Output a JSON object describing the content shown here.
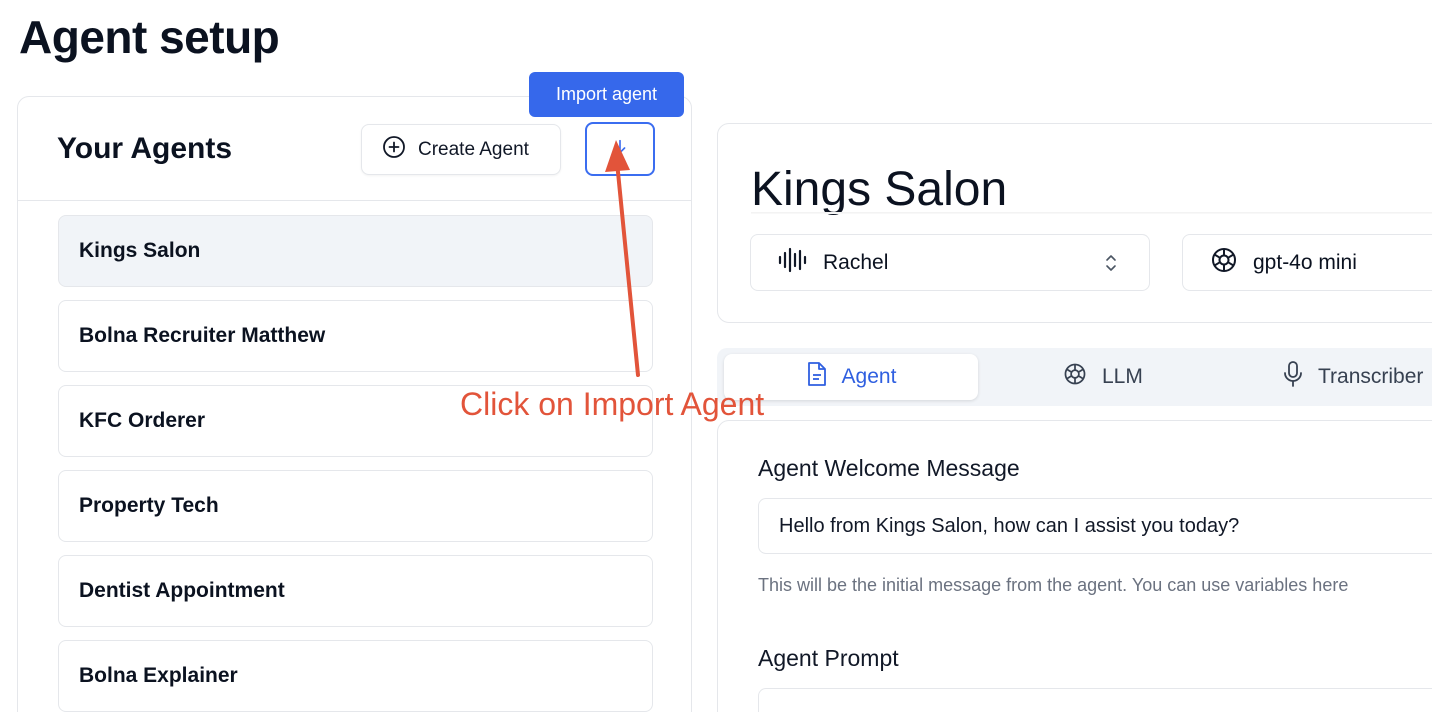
{
  "page": {
    "title": "Agent setup"
  },
  "left_panel": {
    "title": "Your Agents",
    "create_button_label": "Create Agent",
    "import_tooltip": "Import agent",
    "agents": [
      {
        "label": "Kings Salon",
        "active": true
      },
      {
        "label": "Bolna Recruiter Matthew",
        "active": false
      },
      {
        "label": "KFC Orderer",
        "active": false
      },
      {
        "label": "Property Tech",
        "active": false
      },
      {
        "label": "Dentist Appointment",
        "active": false
      },
      {
        "label": "Bolna Explainer",
        "active": false
      }
    ]
  },
  "agent_card": {
    "name": "Kings Salon",
    "voice": "Rachel",
    "llm": "gpt-4o mini"
  },
  "tabs": [
    {
      "label": "Agent",
      "icon": "document-icon",
      "active": true
    },
    {
      "label": "LLM",
      "icon": "openai-icon",
      "active": false
    },
    {
      "label": "Transcriber",
      "icon": "microphone-icon",
      "active": false
    }
  ],
  "content": {
    "welcome_label": "Agent Welcome Message",
    "welcome_value": "Hello from Kings Salon, how can I assist you today?",
    "welcome_hint": "This will be the initial message from the agent. You can use variables here",
    "prompt_label": "Agent Prompt"
  },
  "annotation": {
    "text": "Click on Import Agent",
    "color": "#e2543a"
  },
  "colors": {
    "accent": "#3668eb",
    "active_item_bg": "#f1f4f8",
    "border": "#e5e7eb"
  }
}
